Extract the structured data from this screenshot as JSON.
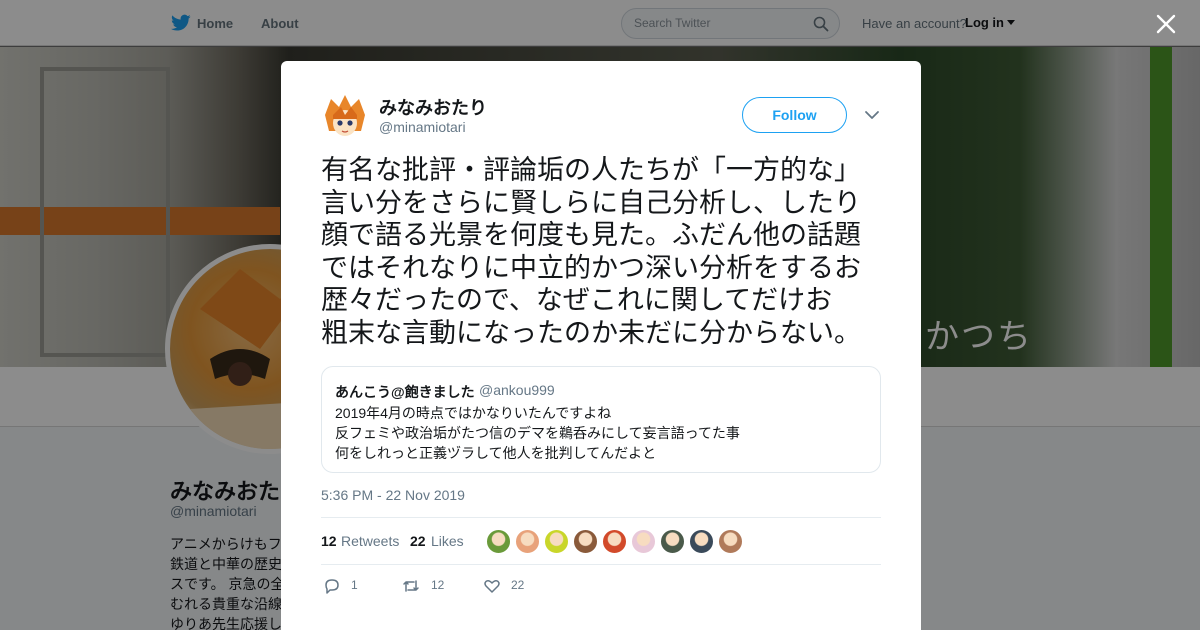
{
  "nav": {
    "home": "Home",
    "about": "About",
    "search_placeholder": "Search Twitter",
    "have_account": "Have an account?",
    "login": "Log in"
  },
  "banner": {
    "sign_text": "かつち"
  },
  "profile": {
    "name": "みなみおたり",
    "handle": "@minamiotari",
    "bio_lines": [
      "アニメからけもフ",
      "鉄道と中華の歴史",
      "スです。 京急の全",
      "むれる貴重な沿線",
      "ゆりあ先生応援し"
    ]
  },
  "tweet": {
    "author_name": "みなみおたり",
    "author_handle": "@minamiotari",
    "follow_label": "Follow",
    "text": "有名な批評・評論垢の人たちが「一方的な」\n言い分をさらに賢しらに自己分析し、したり\n顔で語る光景を何度も見た。ふだん他の話題\nではそれなりに中立的かつ深い分析をするお\n歴々だったので、なぜこれに関してだけお\n粗末な言動になったのか未だに分からない。",
    "quote": {
      "name": "あんこう@飽きました",
      "handle": "@ankou999",
      "lines": [
        "2019年4月の時点ではかなりいたんですよね",
        "反フェミや政治垢がたつ信のデマを鵜呑みにして妄言語ってた事",
        "何をしれっと正義ヅラして他人を批判してんだよと"
      ]
    },
    "timestamp": "5:36 PM - 22 Nov 2019",
    "retweets": "12",
    "retweets_label": "Retweets",
    "likes": "22",
    "likes_label": "Likes",
    "reply_count": "1",
    "retweet_count": "12",
    "like_count": "22",
    "liker_colors": [
      "#6a9a3a",
      "#e8a27a",
      "#c9d62a",
      "#8a5a3a",
      "#d24a2a",
      "#e8c8d8",
      "#4a5a4a",
      "#3a4a5a",
      "#b07a5a"
    ]
  },
  "colors": {
    "accent": "#1da1f2",
    "text": "#14171a",
    "muted": "#657786"
  }
}
